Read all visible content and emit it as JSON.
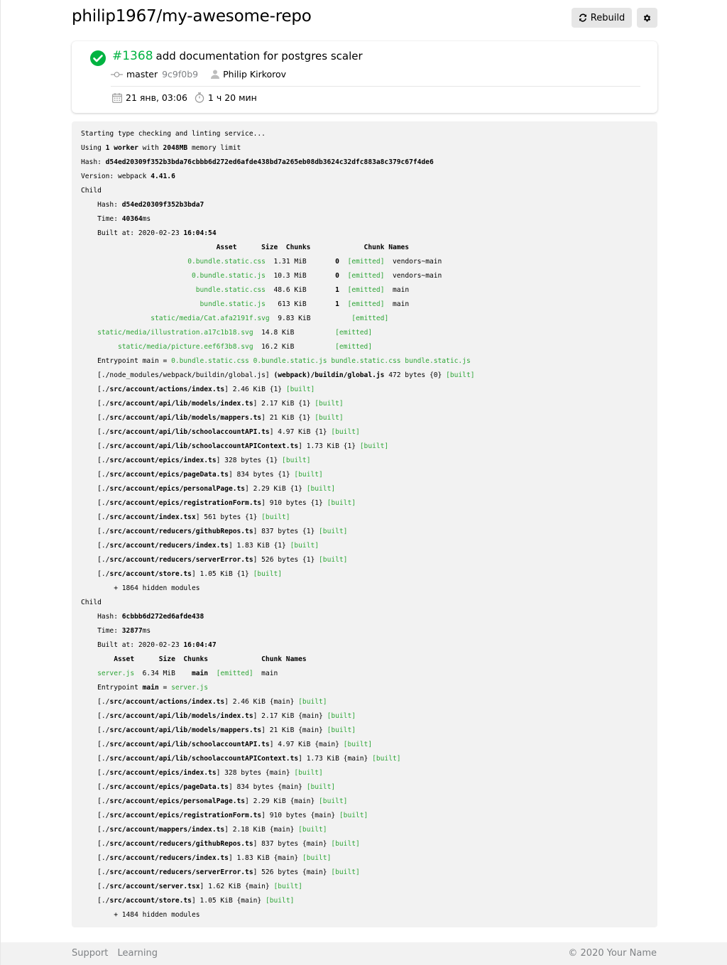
{
  "header": {
    "repo": "philip1967/my-awesome-repo",
    "rebuild_label": "Rebuild"
  },
  "build": {
    "number": "#1368",
    "message": "add documentation for postgres scaler",
    "branch": "master",
    "commit": "9c9f0b9",
    "author": "Philip Kirkorov",
    "date": "21 янв, 03:06",
    "duration": "1 ч 20 мин",
    "status": "success",
    "status_color": "#00b341"
  },
  "colors": {
    "accent": "#2ea537",
    "log_bg": "#f2f2f2",
    "button_bg": "#e6e6e6"
  },
  "log_lines": [
    [
      {
        "t": "Starting type checking and linting service..."
      }
    ],
    [
      {
        "t": "Using "
      },
      {
        "t": "1",
        "b": 1
      },
      {
        "t": " "
      },
      {
        "t": "worker",
        "b": 1
      },
      {
        "t": " with "
      },
      {
        "t": "2048MB",
        "b": 1
      },
      {
        "t": " memory limit"
      }
    ],
    [
      {
        "t": "Hash: "
      },
      {
        "t": "d54ed20309f352b3bda76cbbb6d272ed6afde438bd7a265eb08db3624c32dfc883a8c379c67f4de6",
        "b": 1
      }
    ],
    [
      {
        "t": "Version: webpack "
      },
      {
        "t": "4.41.6",
        "b": 1
      }
    ],
    [
      {
        "t": "Child"
      }
    ],
    [
      {
        "t": "    Hash: "
      },
      {
        "t": "d54ed20309f352b3bda7",
        "b": 1
      }
    ],
    [
      {
        "t": "    Time: "
      },
      {
        "t": "40364",
        "b": 1
      },
      {
        "t": "ms"
      }
    ],
    [
      {
        "t": "    Built at: 2020-02-23 "
      },
      {
        "t": "16:04:54",
        "b": 1
      }
    ],
    [
      {
        "t": "                                 "
      },
      {
        "t": "Asset      Size  Chunks             Chunk Names",
        "b": 1
      }
    ],
    [
      {
        "t": "                          "
      },
      {
        "t": "0.bundle.static.css",
        "g": 1
      },
      {
        "t": "  1.31 MiB       "
      },
      {
        "t": "0",
        "b": 1
      },
      {
        "t": "  "
      },
      {
        "t": "[emitted]",
        "g": 1
      },
      {
        "t": "  vendors~main"
      }
    ],
    [
      {
        "t": "                           "
      },
      {
        "t": "0.bundle.static.js",
        "g": 1
      },
      {
        "t": "  10.3 MiB       "
      },
      {
        "t": "0",
        "b": 1
      },
      {
        "t": "  "
      },
      {
        "t": "[emitted]",
        "g": 1
      },
      {
        "t": "  vendors~main"
      }
    ],
    [
      {
        "t": "                            "
      },
      {
        "t": "bundle.static.css",
        "g": 1
      },
      {
        "t": "  48.6 KiB       "
      },
      {
        "t": "1",
        "b": 1
      },
      {
        "t": "  "
      },
      {
        "t": "[emitted]",
        "g": 1
      },
      {
        "t": "  main"
      }
    ],
    [
      {
        "t": "                             "
      },
      {
        "t": "bundle.static.js",
        "g": 1
      },
      {
        "t": "   613 KiB       "
      },
      {
        "t": "1",
        "b": 1
      },
      {
        "t": "  "
      },
      {
        "t": "[emitted]",
        "g": 1
      },
      {
        "t": "  main"
      }
    ],
    [
      {
        "t": "                 "
      },
      {
        "t": "static/media/Cat.afa2191f.svg",
        "g": 1
      },
      {
        "t": "  9.83 KiB          "
      },
      {
        "t": "[emitted]",
        "g": 1
      }
    ],
    [
      {
        "t": "    "
      },
      {
        "t": "static/media/illustration.a17c1b18.svg",
        "g": 1
      },
      {
        "t": "  14.8 KiB          "
      },
      {
        "t": "[emitted]",
        "g": 1
      }
    ],
    [
      {
        "t": "         "
      },
      {
        "t": "static/media/picture.eef6f3b8.svg",
        "g": 1
      },
      {
        "t": "  16.2 KiB          "
      },
      {
        "t": "[emitted]",
        "g": 1
      }
    ],
    [
      {
        "t": "    Entrypoint main = "
      },
      {
        "t": "0.bundle.static.css 0.bundle.static.js bundle.static.css bundle.static.js",
        "g": 1
      }
    ],
    [
      {
        "t": "    [./node_modules/webpack/buildin/global.js] "
      },
      {
        "t": "(webpack)/buildin/global.js",
        "b": 1
      },
      {
        "t": " 472 bytes {0} "
      },
      {
        "t": "[built]",
        "g": 1
      }
    ],
    [
      {
        "t": "    [./"
      },
      {
        "t": "src/account/actions/index.ts",
        "b": 1
      },
      {
        "t": "] 2.46 KiB {1} "
      },
      {
        "t": "[built]",
        "g": 1
      }
    ],
    [
      {
        "t": "    [./"
      },
      {
        "t": "src/account/api/lib/models/index.ts",
        "b": 1
      },
      {
        "t": "] 2.17 KiB {1} "
      },
      {
        "t": "[built]",
        "g": 1
      }
    ],
    [
      {
        "t": "    [./"
      },
      {
        "t": "src/account/api/lib/models/mappers.ts",
        "b": 1
      },
      {
        "t": "] 21 KiB {1} "
      },
      {
        "t": "[built]",
        "g": 1
      }
    ],
    [
      {
        "t": "    [./"
      },
      {
        "t": "src/account/api/lib/schoolaccountAPI.ts",
        "b": 1
      },
      {
        "t": "] 4.97 KiB {1} "
      },
      {
        "t": "[built]",
        "g": 1
      }
    ],
    [
      {
        "t": "    [./"
      },
      {
        "t": "src/account/api/lib/schoolaccountAPIContext.ts",
        "b": 1
      },
      {
        "t": "] 1.73 KiB {1} "
      },
      {
        "t": "[built]",
        "g": 1
      }
    ],
    [
      {
        "t": "    [./"
      },
      {
        "t": "src/account/epics/index.ts",
        "b": 1
      },
      {
        "t": "] 328 bytes {1} "
      },
      {
        "t": "[built]",
        "g": 1
      }
    ],
    [
      {
        "t": "    [./"
      },
      {
        "t": "src/account/epics/pageData.ts",
        "b": 1
      },
      {
        "t": "] 834 bytes {1} "
      },
      {
        "t": "[built]",
        "g": 1
      }
    ],
    [
      {
        "t": "    [./"
      },
      {
        "t": "src/account/epics/personalPage.ts",
        "b": 1
      },
      {
        "t": "] 2.29 KiB {1} "
      },
      {
        "t": "[built]",
        "g": 1
      }
    ],
    [
      {
        "t": "    [./"
      },
      {
        "t": "src/account/epics/registrationForm.ts",
        "b": 1
      },
      {
        "t": "] 910 bytes {1} "
      },
      {
        "t": "[built]",
        "g": 1
      }
    ],
    [
      {
        "t": "    [./"
      },
      {
        "t": "src/account/index.tsx",
        "b": 1
      },
      {
        "t": "] 561 bytes {1} "
      },
      {
        "t": "[built]",
        "g": 1
      }
    ],
    [
      {
        "t": "    [./"
      },
      {
        "t": "src/account/reducers/githubRepos.ts",
        "b": 1
      },
      {
        "t": "] 837 bytes {1} "
      },
      {
        "t": "[built]",
        "g": 1
      }
    ],
    [
      {
        "t": "    [./"
      },
      {
        "t": "src/account/reducers/index.ts",
        "b": 1
      },
      {
        "t": "] 1.83 KiB {1} "
      },
      {
        "t": "[built]",
        "g": 1
      }
    ],
    [
      {
        "t": "    [./"
      },
      {
        "t": "src/account/reducers/serverError.ts",
        "b": 1
      },
      {
        "t": "] 526 bytes {1} "
      },
      {
        "t": "[built]",
        "g": 1
      }
    ],
    [
      {
        "t": "    [./"
      },
      {
        "t": "src/account/store.ts",
        "b": 1
      },
      {
        "t": "] 1.05 KiB {1} "
      },
      {
        "t": "[built]",
        "g": 1
      }
    ],
    [
      {
        "t": "        + 1864 hidden modules"
      }
    ],
    [
      {
        "t": "Child"
      }
    ],
    [
      {
        "t": "    Hash: "
      },
      {
        "t": "6cbbb6d272ed6afde438",
        "b": 1
      }
    ],
    [
      {
        "t": "    Time: "
      },
      {
        "t": "32877",
        "b": 1
      },
      {
        "t": "ms"
      }
    ],
    [
      {
        "t": "    Built at: 2020-02-23 "
      },
      {
        "t": "16:04:47",
        "b": 1
      }
    ],
    [
      {
        "t": "        "
      },
      {
        "t": "Asset      Size  Chunks             Chunk Names",
        "b": 1
      }
    ],
    [
      {
        "t": "    "
      },
      {
        "t": "server.js",
        "g": 1
      },
      {
        "t": "  6.34 MiB    "
      },
      {
        "t": "main",
        "b": 1
      },
      {
        "t": "  "
      },
      {
        "t": "[emitted]",
        "g": 1
      },
      {
        "t": "  main"
      }
    ],
    [
      {
        "t": "    Entrypoint "
      },
      {
        "t": "main",
        "b": 1
      },
      {
        "t": " = "
      },
      {
        "t": "server.js",
        "g": 1
      }
    ],
    [
      {
        "t": "    [./"
      },
      {
        "t": "src/account/actions/index.ts",
        "b": 1
      },
      {
        "t": "] 2.46 KiB {main} "
      },
      {
        "t": "[built]",
        "g": 1
      }
    ],
    [
      {
        "t": "    [./"
      },
      {
        "t": "src/account/api/lib/models/index.ts",
        "b": 1
      },
      {
        "t": "] 2.17 KiB {main} "
      },
      {
        "t": "[built]",
        "g": 1
      }
    ],
    [
      {
        "t": "    [./"
      },
      {
        "t": "src/account/api/lib/models/mappers.ts",
        "b": 1
      },
      {
        "t": "] 21 KiB {main} "
      },
      {
        "t": "[built]",
        "g": 1
      }
    ],
    [
      {
        "t": "    [./"
      },
      {
        "t": "src/account/api/lib/schoolaccountAPI.ts",
        "b": 1
      },
      {
        "t": "] 4.97 KiB {main} "
      },
      {
        "t": "[built]",
        "g": 1
      }
    ],
    [
      {
        "t": "    [./"
      },
      {
        "t": "src/account/api/lib/schoolaccountAPIContext.ts",
        "b": 1
      },
      {
        "t": "] 1.73 KiB {main} "
      },
      {
        "t": "[built]",
        "g": 1
      }
    ],
    [
      {
        "t": "    [./"
      },
      {
        "t": "src/account/epics/index.ts",
        "b": 1
      },
      {
        "t": "] 328 bytes {main} "
      },
      {
        "t": "[built]",
        "g": 1
      }
    ],
    [
      {
        "t": "    [./"
      },
      {
        "t": "src/account/epics/pageData.ts",
        "b": 1
      },
      {
        "t": "] 834 bytes {main} "
      },
      {
        "t": "[built]",
        "g": 1
      }
    ],
    [
      {
        "t": "    [./"
      },
      {
        "t": "src/account/epics/personalPage.ts",
        "b": 1
      },
      {
        "t": "] 2.29 KiB {main} "
      },
      {
        "t": "[built]",
        "g": 1
      }
    ],
    [
      {
        "t": "    [./"
      },
      {
        "t": "src/account/epics/registrationForm.ts",
        "b": 1
      },
      {
        "t": "] 910 bytes {main} "
      },
      {
        "t": "[built]",
        "g": 1
      }
    ],
    [
      {
        "t": "    [./"
      },
      {
        "t": "src/account/mappers/index.ts",
        "b": 1
      },
      {
        "t": "] 2.18 KiB {main} "
      },
      {
        "t": "[built]",
        "g": 1
      }
    ],
    [
      {
        "t": "    [./"
      },
      {
        "t": "src/account/reducers/githubRepos.ts",
        "b": 1
      },
      {
        "t": "] 837 bytes {main} "
      },
      {
        "t": "[built]",
        "g": 1
      }
    ],
    [
      {
        "t": "    [./"
      },
      {
        "t": "src/account/reducers/index.ts",
        "b": 1
      },
      {
        "t": "] 1.83 KiB {main} "
      },
      {
        "t": "[built]",
        "g": 1
      }
    ],
    [
      {
        "t": "    [./"
      },
      {
        "t": "src/account/reducers/serverError.ts",
        "b": 1
      },
      {
        "t": "] 526 bytes {main} "
      },
      {
        "t": "[built]",
        "g": 1
      }
    ],
    [
      {
        "t": "    [./"
      },
      {
        "t": "src/account/server.tsx",
        "b": 1
      },
      {
        "t": "] 1.62 KiB {main} "
      },
      {
        "t": "[built]",
        "g": 1
      }
    ],
    [
      {
        "t": "    [./"
      },
      {
        "t": "src/account/store.ts",
        "b": 1
      },
      {
        "t": "] 1.05 KiB {main} "
      },
      {
        "t": "[built]",
        "g": 1
      }
    ],
    [
      {
        "t": "        + 1484 hidden modules"
      }
    ]
  ],
  "footer": {
    "links": [
      "Support",
      "Learning"
    ],
    "copyright": "© 2020 Your Name"
  }
}
